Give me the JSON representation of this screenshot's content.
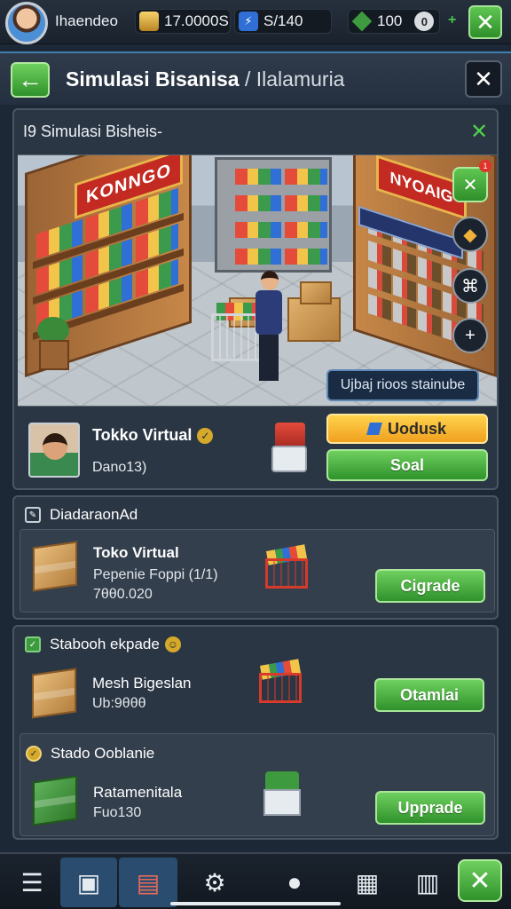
{
  "topbar": {
    "player_name": "Ihaendeo",
    "coins": "17.0000S",
    "energy": "S/140",
    "gems": "100",
    "gems_end": "0"
  },
  "header": {
    "title": "Simulasi Bisanisa",
    "subtitle": "/ Ilalamuria"
  },
  "main_panel": {
    "title": "I9 Simulasi Bisheis-",
    "sign_left": "KONNGO",
    "sign_right": "NYOAIG",
    "scene_status": "Ujbaj rioos stainube",
    "store": {
      "name": "Tokko Virtual",
      "sub": "Dano13)",
      "btn_primary": "Uodusk",
      "btn_secondary": "Soal"
    }
  },
  "section1": {
    "heading": "DiadaraonAd",
    "item": {
      "name": "Toko Virtual",
      "line1": "Pepenie Foppi (1/1)",
      "line2": "7θθ0.020",
      "button": "Cigrade"
    }
  },
  "section2": {
    "heading": "Stabooh ekpade",
    "item1": {
      "name": "Mesh Bigeslan",
      "value": "Ub:9θθθ",
      "button": "Otamlai"
    },
    "heading2": "Stado Ooblanie",
    "item2": {
      "name": "Ratamenitala",
      "value": "Fuo130",
      "button": "Upprade"
    }
  },
  "nav": {
    "items": [
      "menu-icon",
      "cube-icon",
      "store-icon",
      "settings-icon",
      "profile-icon",
      "calculator-icon",
      "storage-icon",
      "tools-icon"
    ]
  },
  "colors": {
    "accent_green": "#4fb245",
    "accent_yellow": "#f5b52e",
    "panel_bg": "#2b3644",
    "page_bg": "#1d2836"
  }
}
